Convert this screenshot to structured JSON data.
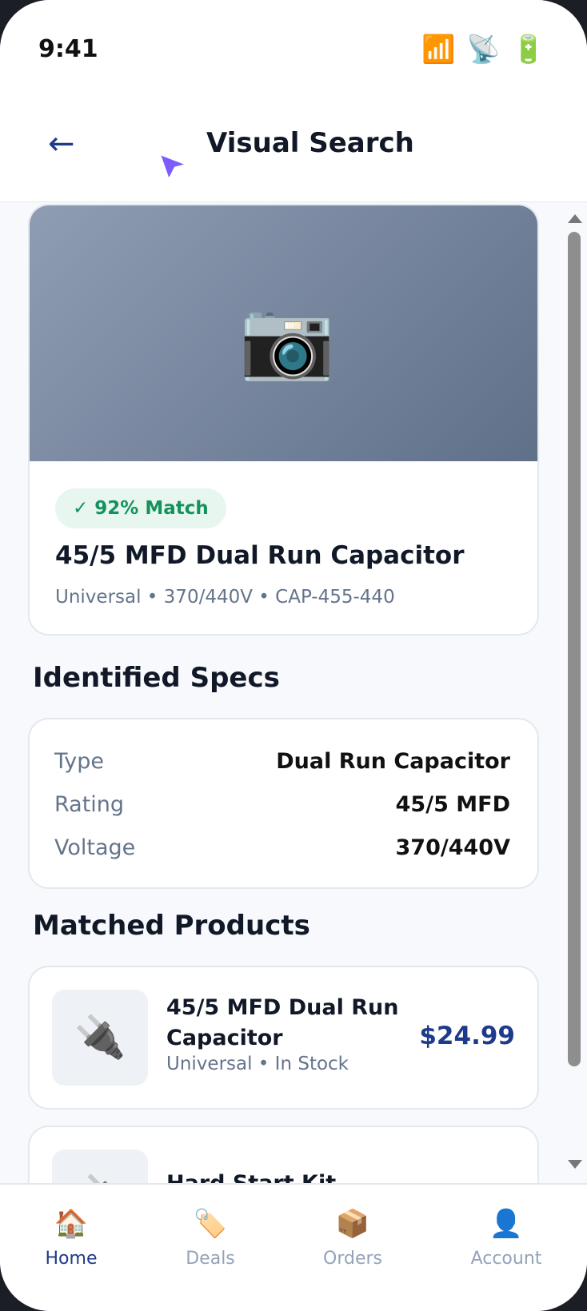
{
  "status_bar": {
    "time": "9:41",
    "icons": [
      {
        "name": "signal-icon",
        "glyph": "📶"
      },
      {
        "name": "wifi-icon",
        "glyph": "📡"
      },
      {
        "name": "battery-icon",
        "glyph": "🔋"
      }
    ]
  },
  "header": {
    "back_glyph": "←",
    "title": "Visual Search"
  },
  "match": {
    "image_glyph": "📷",
    "badge": "✓ 92% Match",
    "title": "45/5 MFD Dual Run Capacitor",
    "subtitle": "Universal • 370/440V • CAP-455-440"
  },
  "specs": {
    "title": "Identified Specs",
    "rows": [
      {
        "label": "Type",
        "value": "Dual Run Capacitor"
      },
      {
        "label": "Rating",
        "value": "45/5 MFD"
      },
      {
        "label": "Voltage",
        "value": "370/440V"
      }
    ]
  },
  "products": {
    "title": "Matched Products",
    "items": [
      {
        "name": "45/5 MFD Dual Run Capacitor",
        "sub": "Universal • In Stock",
        "price": "$24.99",
        "glyph": "🔌"
      },
      {
        "name": "Hard Start Kit",
        "sub": "",
        "price": "",
        "glyph": "🔌"
      }
    ]
  },
  "nav": {
    "items": [
      {
        "label": "Home",
        "glyph": "🏠",
        "active": true
      },
      {
        "label": "Deals",
        "glyph": "🏷️",
        "active": false
      },
      {
        "label": "Orders",
        "glyph": "📦",
        "active": false
      },
      {
        "label": "Account",
        "glyph": "👤",
        "active": false
      }
    ]
  },
  "colors": {
    "accent": "#1e3a8a",
    "match_green": "#15925c",
    "muted": "#64748b",
    "nav_inactive": "#94a3b8",
    "cursor": "#7c5cff"
  }
}
